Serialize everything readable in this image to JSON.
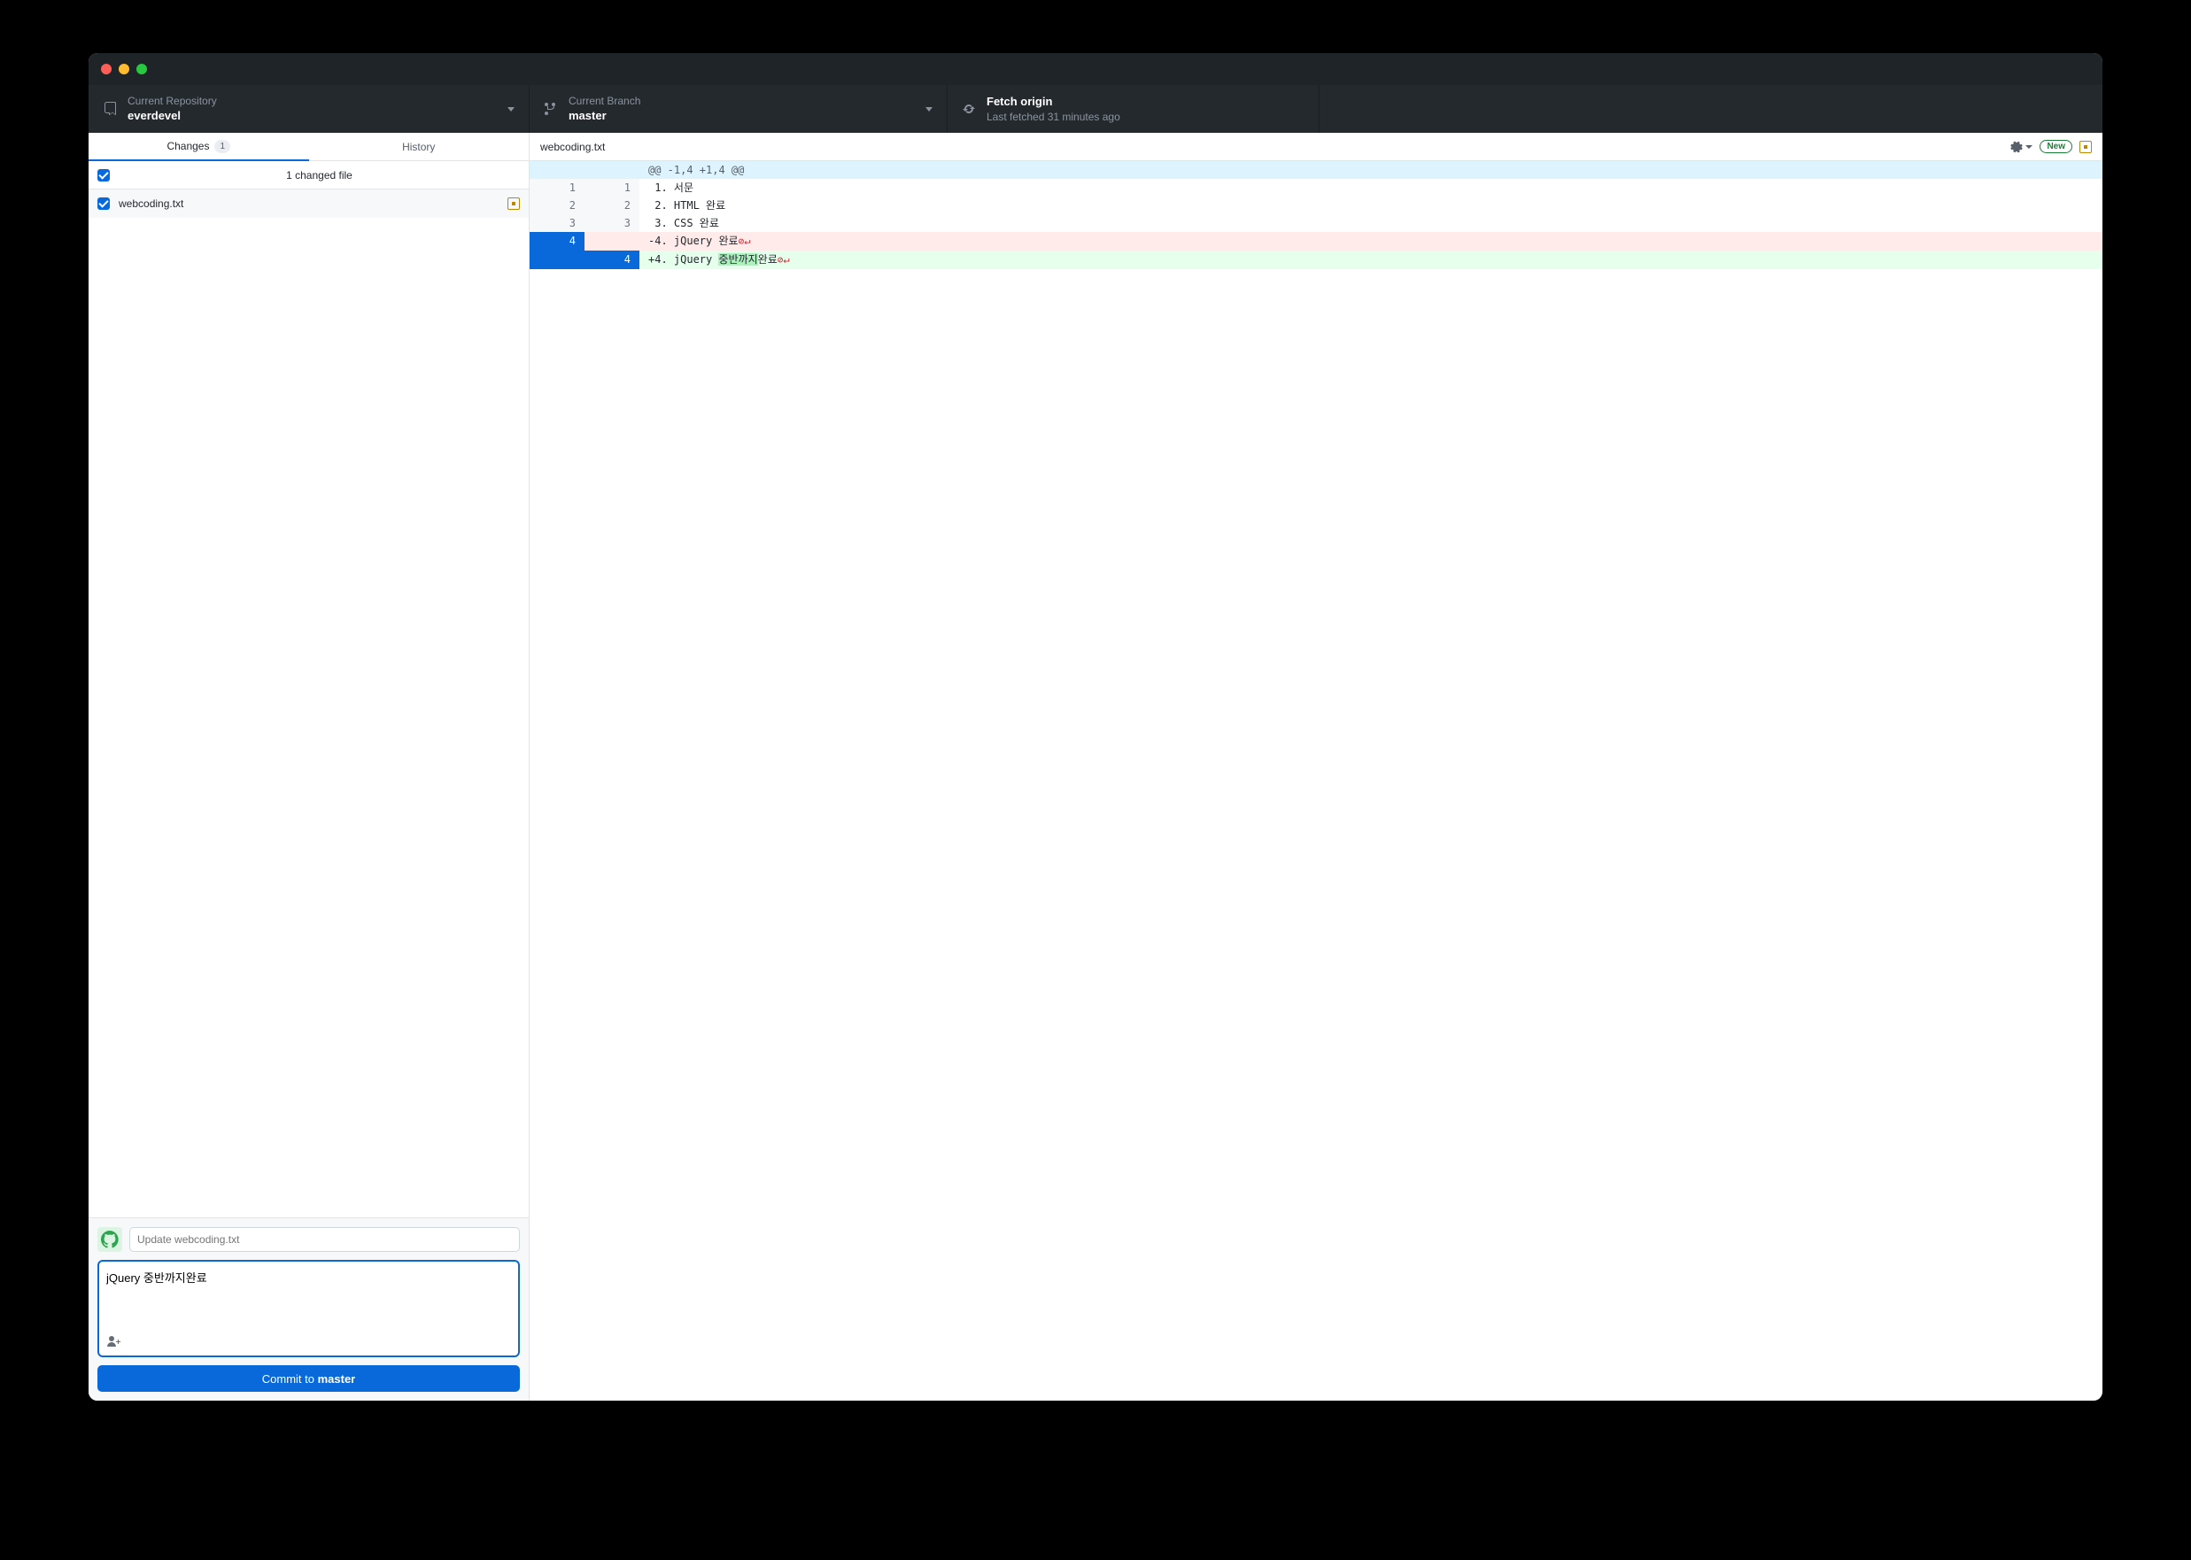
{
  "toolbar": {
    "repo_label": "Current Repository",
    "repo_value": "everdevel",
    "branch_label": "Current Branch",
    "branch_value": "master",
    "fetch_label": "Fetch origin",
    "fetch_value": "Last fetched 31 minutes ago"
  },
  "tabs": {
    "changes": "Changes",
    "changes_count": "1",
    "history": "History"
  },
  "changed_files_label": "1 changed file",
  "file": {
    "name": "webcoding.txt"
  },
  "commit": {
    "summary_placeholder": "Update webcoding.txt",
    "description": "jQuery 중반까지완료",
    "button_prefix": "Commit to ",
    "button_branch": "master"
  },
  "diff_header": {
    "filename": "webcoding.txt",
    "new_badge": "New"
  },
  "diff": {
    "hunk": "@@ -1,4 +1,4 @@",
    "rows": [
      {
        "a": "1",
        "b": "1",
        "prefix": " ",
        "text": "1. 서문"
      },
      {
        "a": "2",
        "b": "2",
        "prefix": " ",
        "text": "2. HTML 완료"
      },
      {
        "a": "3",
        "b": "3",
        "prefix": " ",
        "text": "3. CSS 완료"
      }
    ],
    "del": {
      "a": "4",
      "prefix": "-",
      "text": "4. jQuery 완료"
    },
    "add": {
      "b": "4",
      "prefix": "+",
      "text_pre": "4. jQuery ",
      "text_hl": "중반까지",
      "text_post": "완료"
    }
  }
}
